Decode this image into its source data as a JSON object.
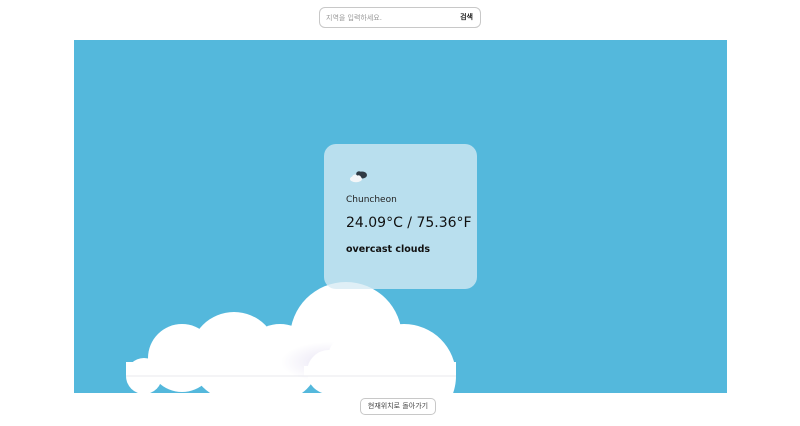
{
  "search": {
    "placeholder": "지역을 입력하세요.",
    "button_label": "검색"
  },
  "weather": {
    "icon": "overcast-clouds-icon",
    "city": "Chuncheon",
    "temperature": "24.09°C / 75.36°F",
    "description": "overcast clouds"
  },
  "footer": {
    "location_button_label": "현재위치로 돌아가기"
  },
  "colors": {
    "sky": "#54b8dc",
    "card": "#d6eaf3",
    "cloud": "#ffffff"
  }
}
